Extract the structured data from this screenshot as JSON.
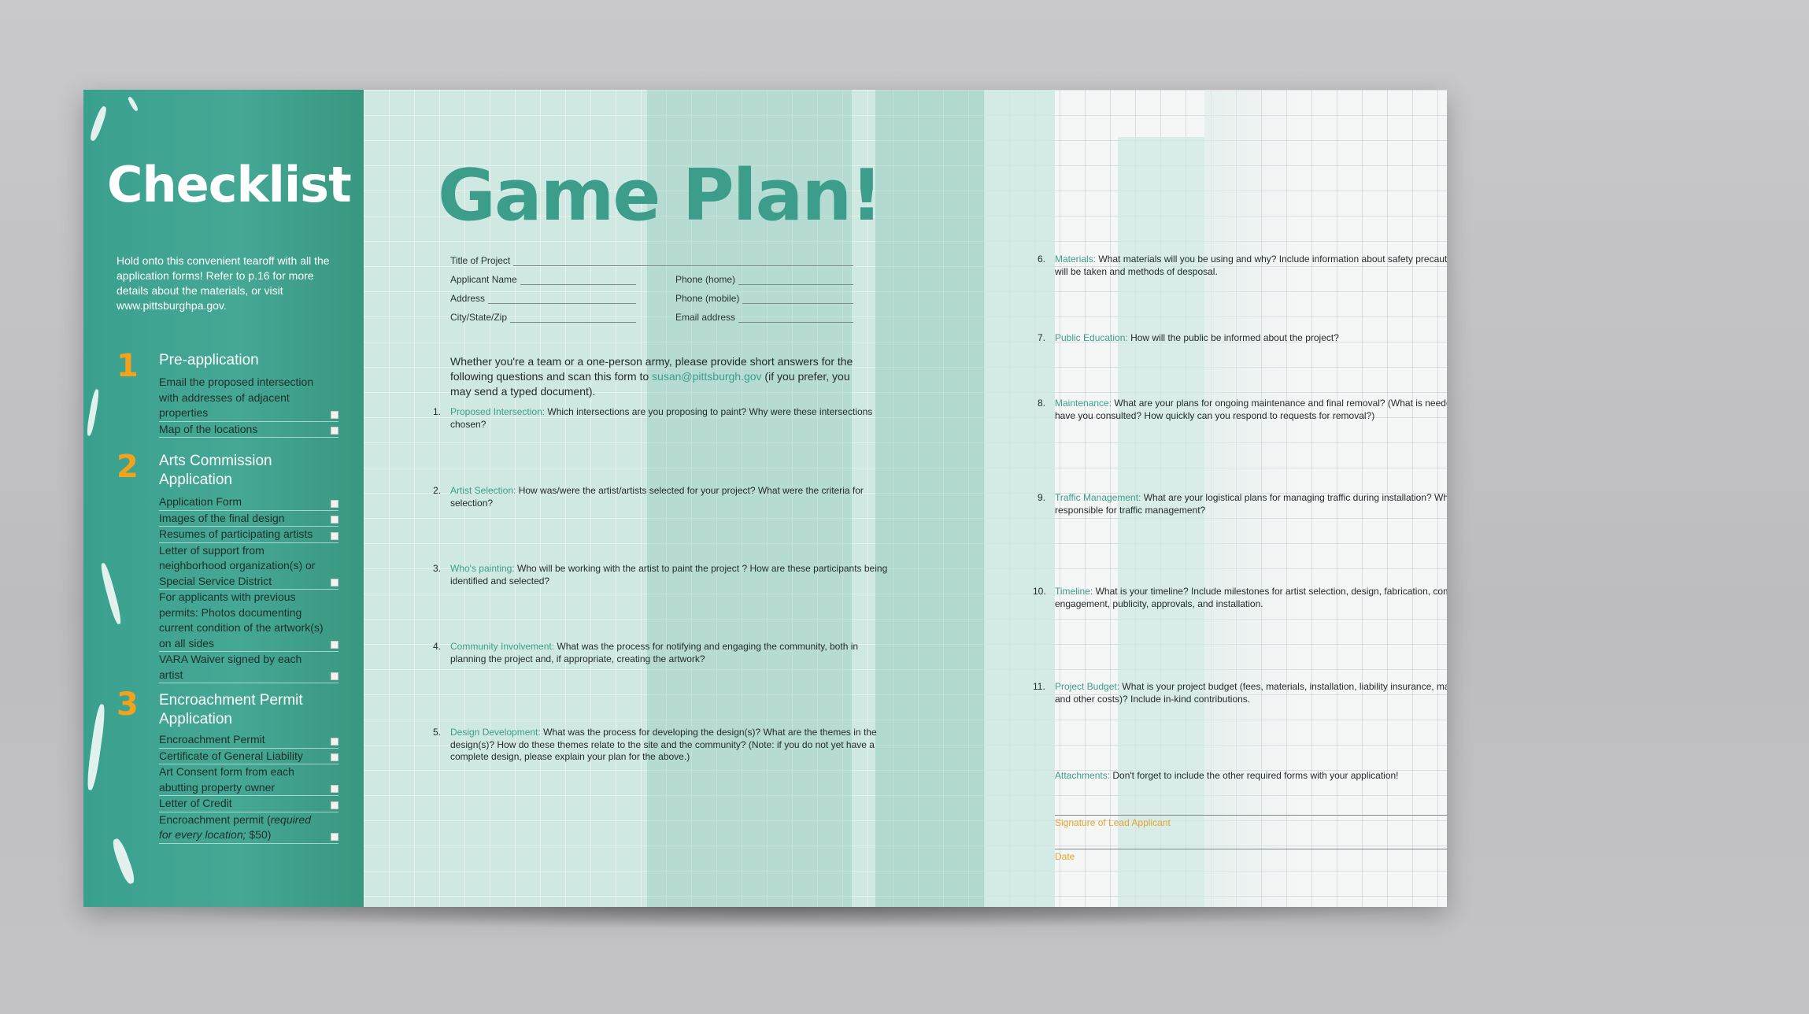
{
  "checklist": {
    "title": "Checklist",
    "intro": "Hold onto this convenient tearoff with all the application forms! Refer to p.16 for more details about the materials, or visit www.pittsburghpa.gov.",
    "sections": [
      {
        "number": "1",
        "title": "Pre-application",
        "items": [
          "Email the proposed intersection with addresses of adjacent properties",
          "Map of the locations"
        ]
      },
      {
        "number": "2",
        "title": "Arts Commission Application",
        "items": [
          "Application Form",
          "Images of the final design",
          "Resumes of participating artists",
          "Letter of support from neighborhood organization(s) or Special Service District",
          "For applicants with previous permits: Photos documenting current condition of the artwork(s) on all sides",
          "VARA Waiver signed by each artist"
        ]
      },
      {
        "number": "3",
        "title": "Encroachment Permit Application",
        "items": [
          "Encroachment Permit",
          "Certificate of General Liability",
          "Art Consent form from each abutting property owner",
          "Letter of Credit",
          "Encroachment permit (required for every location; $50)"
        ]
      }
    ],
    "last_item_prefix": "Encroachment permit (",
    "last_item_italic": "required for every location;",
    "last_item_suffix": " $50)"
  },
  "game_plan": {
    "title": "Game Plan!",
    "fields": {
      "title_of_project": "Title of Project",
      "applicant_name": "Applicant Name",
      "address": "Address",
      "city_state_zip": "City/State/Zip",
      "phone_home": "Phone (home)",
      "phone_mobile": "Phone (mobile)",
      "email_address": "Email address"
    },
    "intro_before": "Whether you're a team or a one-person army, please provide short answers for the following questions and scan this form to ",
    "intro_email": "susan@pittsburgh.gov",
    "intro_after": " (if you prefer, you may send a typed document).",
    "questions": [
      {
        "num": "1.",
        "label": "Proposed Intersection:",
        "text": " Which intersections are you proposing to paint? Why were these intersections chosen?"
      },
      {
        "num": "2.",
        "label": "Artist Selection:",
        "text": " How was/were the artist/artists selected for your project? What were the criteria for selection?"
      },
      {
        "num": "3.",
        "label": "Who's painting:",
        "text": " Who will be working with the artist to paint the project ? How are these participants being identified and selected?"
      },
      {
        "num": "4.",
        "label": "Community Involvement:",
        "text": " What was the process for notifying and engaging the community, both in planning the project and, if appropriate, creating the artwork?"
      },
      {
        "num": "5.",
        "label": "Design Development:",
        "text": " What was the process for developing the design(s)?  What are the themes in the design(s)? How do these themes relate to the site and the community? (Note: if you do not yet have a complete design, please explain your plan for the above.)"
      }
    ]
  },
  "right_page": {
    "questions": [
      {
        "num": "6.",
        "label": "Materials:",
        "text": " What materials will you be using and why? Include information about safety precautions that will be taken and methods of desposal."
      },
      {
        "num": "7.",
        "label": "Public Education:",
        "text": " How will the public be informed about the project?"
      },
      {
        "num": "8.",
        "label": "Maintenance:",
        "text": " What are your plans for ongoing maintenance and final removal? (What is needed)? Who have you consulted? How quickly can you respond to requests for removal?)"
      },
      {
        "num": "9.",
        "label": "Traffic Management:",
        "text": " What are your logistical plans for managing traffic during installation? Who is responsible for traffic management?"
      },
      {
        "num": "10.",
        "label": "Timeline:",
        "text": " What is your timeline? Include milestones for artist selection, design, fabrication, community engagement, publicity, approvals, and installation."
      },
      {
        "num": "11.",
        "label": "Project Budget:",
        "text": " What is your project budget (fees, materials, installation, liability insurance, maintenance, and other costs)? Include in-kind contributions."
      }
    ],
    "attachments_label": "Attachments:",
    "attachments_text": " Don't forget to include the other required forms with your application!",
    "signature_label": "Signature of Lead Applicant",
    "date_label": "Date"
  },
  "colors": {
    "teal": "#3c9e8a",
    "orange": "#f2a31b",
    "tearoff_green": "#45a895"
  }
}
